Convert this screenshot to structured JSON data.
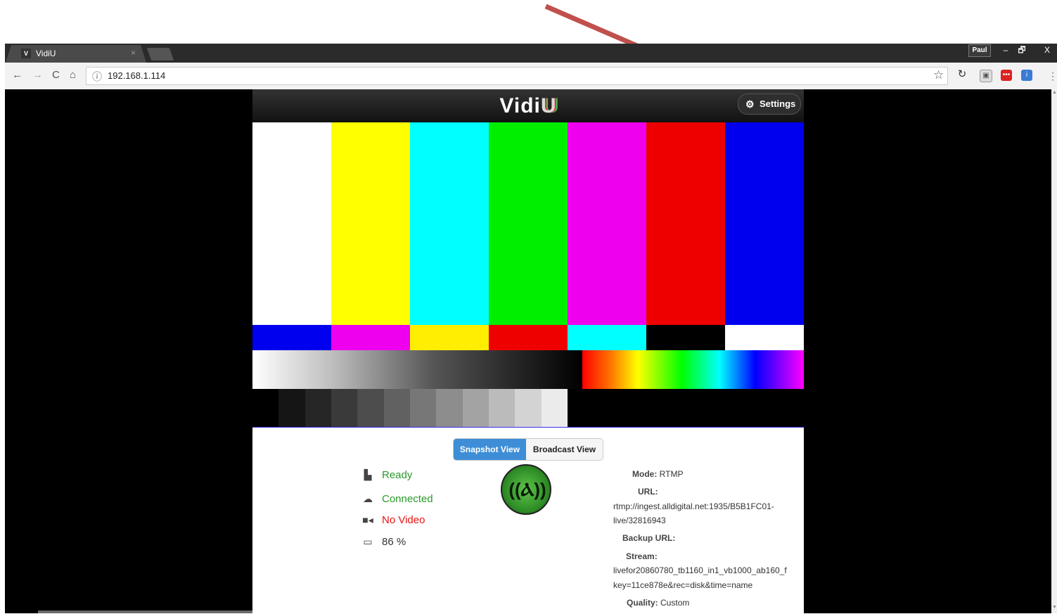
{
  "browser": {
    "tab_title": "VidiU",
    "tab_close": "×",
    "favicon": "V",
    "user": "Paul",
    "url": "192.168.1.114",
    "window_buttons": [
      "–",
      "🗗",
      "X"
    ],
    "nav_icons": [
      "←",
      "→",
      "C",
      "⌂"
    ]
  },
  "app": {
    "logo": "Vidi",
    "logo_u": "U",
    "settings_label": "Settings",
    "views": [
      "Snapshot View",
      "Broadcast View"
    ],
    "status": {
      "ready": "Ready",
      "connected": "Connected",
      "video": "No Video",
      "battery": "86 %"
    },
    "colors": {
      "ready": "#2a9a2a",
      "connected": "#2a9a2a",
      "video": "#ee1111",
      "battery": "#333333",
      "accent": "#3d8ed6"
    },
    "info": {
      "mode_label": "Mode:",
      "mode_value": "RTMP",
      "url_label": "URL:",
      "url_value_1": "rtmp://ingest.alldigital.net:1935/B5B1FC01-",
      "url_value_2": "live/32816943",
      "backup_label": "Backup URL:",
      "stream_label": "Stream:",
      "stream_value_1": "livefor20860780_tb1160_in1_vb1000_ab160_f",
      "stream_value_2": "key=11ce878e&rec=disk&time=name",
      "quality_label": "Quality:",
      "quality_value": "Custom"
    }
  },
  "pattern": {
    "top_bars": [
      "#ffffff",
      "#ffff00",
      "#00ffff",
      "#00ee00",
      "#ee00ee",
      "#ee0000",
      "#0000ee"
    ],
    "mid_bars": [
      "#0000ee",
      "#ee00ee",
      "#ffee00",
      "#ee0000",
      "#00ffff",
      "#000000",
      "#ffffff"
    ],
    "steps": [
      "#000000",
      "#151515",
      "#262626",
      "#3a3a3a",
      "#4d4d4d",
      "#616161",
      "#777777",
      "#8d8d8d",
      "#a3a3a3",
      "#bbbbbb",
      "#d3d3d3",
      "#ebebeb"
    ]
  }
}
